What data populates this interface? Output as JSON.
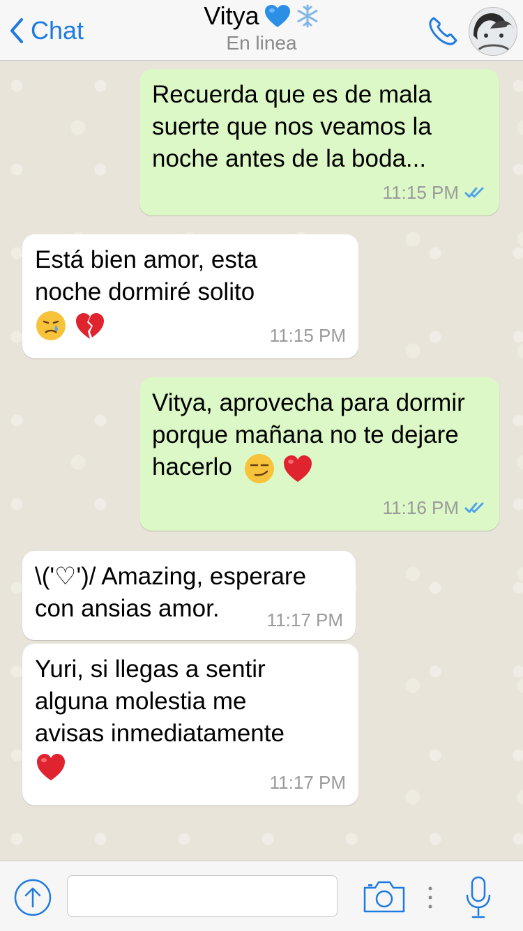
{
  "header": {
    "back_label": "Chat",
    "contact_name": "Vitya",
    "status": "En linea",
    "icons": [
      "chevron-left-icon",
      "blue-heart-icon",
      "snowflake-icon",
      "phone-icon",
      "avatar"
    ]
  },
  "colors": {
    "accent": "#1f7ae0",
    "outgoing_bubble": "#dcf8c6",
    "incoming_bubble": "#ffffff",
    "ticks": "#4fa3e8"
  },
  "messages": [
    {
      "direction": "out",
      "text": "Recuerda que es de mala suerte que nos veamos la noche antes de la boda...",
      "time": "11:15 PM",
      "read": true
    },
    {
      "direction": "in",
      "text": "Está bien amor, esta noche dormiré solito",
      "emojis": [
        "crying-face",
        "broken-heart"
      ],
      "time": "11:15 PM"
    },
    {
      "direction": "out",
      "text": "Vitya, aprovecha para dormir porque mañana no te dejare hacerlo",
      "emojis": [
        "smirking-face",
        "red-heart"
      ],
      "time": "11:16 PM",
      "read": true
    },
    {
      "direction": "in",
      "text": "\\('♡')/ Amazing, esperare con ansias amor.",
      "time": "11:17 PM"
    },
    {
      "direction": "in",
      "text": "Yuri, si llegas a sentir alguna molestia me avisas inmediatamente",
      "emojis": [
        "red-heart"
      ],
      "time": "11:17 PM"
    }
  ],
  "composer": {
    "placeholder": "",
    "value": "",
    "icons": [
      "share-icon",
      "camera-icon",
      "more-dots-icon",
      "microphone-icon"
    ]
  }
}
